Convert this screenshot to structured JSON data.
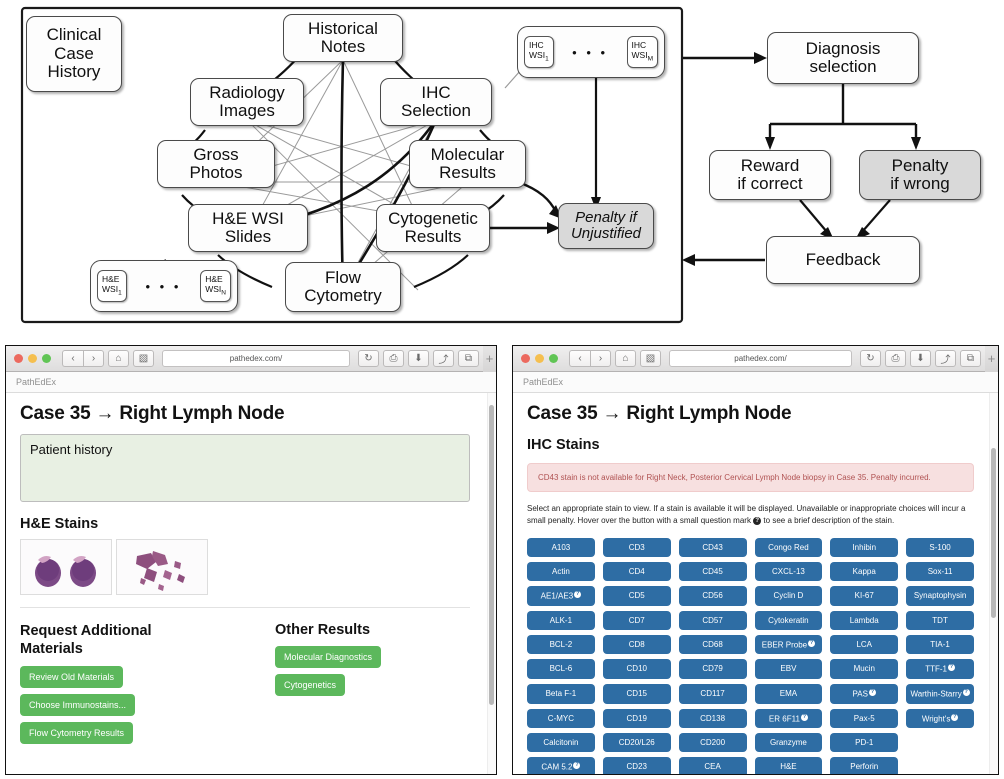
{
  "diagram": {
    "nodes": [
      {
        "id": "clinical",
        "label": "Clinical Case History"
      },
      {
        "id": "historical",
        "label": "Historical Notes"
      },
      {
        "id": "radiology",
        "label": "Radiology Images"
      },
      {
        "id": "ihc",
        "label": "IHC Selection"
      },
      {
        "id": "gross",
        "label": "Gross Photos"
      },
      {
        "id": "molecular",
        "label": "Molecular Results"
      },
      {
        "id": "hewsi",
        "label": "H&E WSI Slides"
      },
      {
        "id": "cytogenetic",
        "label": "Cytogenetic Results"
      },
      {
        "id": "flow",
        "label": "Flow Cytometry"
      },
      {
        "id": "penalty_unjust",
        "label": "Penalty if Unjustified"
      },
      {
        "id": "diagnosis",
        "label": "Diagnosis selection"
      },
      {
        "id": "reward",
        "label": "Reward if correct"
      },
      {
        "id": "penalty_wrong",
        "label": "Penalty if wrong"
      },
      {
        "id": "feedback",
        "label": "Feedback"
      }
    ],
    "clinical_line1": "Clinical",
    "clinical_line2": "Case",
    "clinical_line3": "History",
    "historical_l1": "Historical",
    "historical_l2": "Notes",
    "radiology_l1": "Radiology",
    "radiology_l2": "Images",
    "ihc_l1": "IHC",
    "ihc_l2": "Selection",
    "gross_l1": "Gross",
    "gross_l2": "Photos",
    "molecular_l1": "Molecular",
    "molecular_l2": "Results",
    "hewsi_l1": "H&E WSI",
    "hewsi_l2": "Slides",
    "cyto_l1": "Cytogenetic",
    "cyto_l2": "Results",
    "flow_l1": "Flow",
    "flow_l2": "Cytometry",
    "penalty_unjust_l1": "Penalty if",
    "penalty_unjust_l2": "Unjustified",
    "diagnosis_l1": "Diagnosis",
    "diagnosis_l2": "selection",
    "reward_l1": "Reward",
    "reward_l2": "if correct",
    "penwrong_l1": "Penalty",
    "penwrong_l2": "if wrong",
    "feedback_label": "Feedback",
    "hewsi_group": {
      "first_l1": "H&E",
      "first_l2": "WSI",
      "first_sub": "1",
      "last_l1": "H&E",
      "last_l2": "WSI",
      "last_sub": "N",
      "dots": "• • •"
    },
    "ihcwsi_group": {
      "first_l1": "IHC",
      "first_l2": "WSI",
      "first_sub": "1",
      "last_l1": "IHC",
      "last_l2": "WSI",
      "last_sub": "M",
      "dots": "• • •"
    }
  },
  "browser_left": {
    "url": "pathedex.com/",
    "bookmark": "PathEdEx",
    "title": "Case 35 → Right Lymph Node",
    "history_placeholder": "Patient history",
    "he_stains_heading": "H&E Stains",
    "request_heading_l1": "Request Additional",
    "request_heading_l2": "Materials",
    "other_heading": "Other Results",
    "request_buttons": [
      "Review Old Materials",
      "Choose Immunostains...",
      "Flow Cytometry Results"
    ],
    "other_buttons": [
      "Molecular Diagnostics",
      "Cytogenetics"
    ]
  },
  "browser_right": {
    "url": "pathedex.com/",
    "bookmark": "PathEdEx",
    "title": "Case 35 → Right Lymph Node",
    "ihc_heading": "IHC Stains",
    "alert": "CD43 stain is not available for Right Neck, Posterior Cervical Lymph Node biopsy in Case 35. Penalty incurred.",
    "instructions_a": "Select an appropriate stain to view. If a stain is available it will be displayed. Unavailable or inappropriate choices will incur a small penalty. Hover over the button with a small question mark",
    "instructions_b": "to see a brief description of the stain.",
    "stains": [
      [
        "A103",
        "CD3",
        "CD43",
        "Congo Red",
        "Inhibin",
        "S-100"
      ],
      [
        "Actin",
        "CD4",
        "CD45",
        "CXCL-13",
        "Kappa",
        "Sox-11"
      ],
      [
        "AE1/AE3*",
        "CD5",
        "CD56",
        "Cyclin D",
        "KI-67",
        "Synaptophysin"
      ],
      [
        "ALK-1",
        "CD7",
        "CD57",
        "Cytokeratin",
        "Lambda",
        "TDT"
      ],
      [
        "BCL-2",
        "CD8",
        "CD68",
        "EBER Probe*",
        "LCA",
        "TIA-1"
      ],
      [
        "BCL-6",
        "CD10",
        "CD79",
        "EBV",
        "Mucin",
        "TTF-1*"
      ],
      [
        "Beta F-1",
        "CD15",
        "CD117",
        "EMA",
        "PAS*",
        "Warthin-Starry*"
      ],
      [
        "C-MYC",
        "CD19",
        "CD138",
        "ER 6F11*",
        "Pax-5",
        "Wright's*"
      ],
      [
        "Calcitonin",
        "CD20/L26",
        "CD200",
        "Granzyme",
        "PD-1",
        ""
      ],
      [
        "CAM 5.2*",
        "CD23",
        "CEA",
        "H&E",
        "Perforin",
        ""
      ]
    ]
  },
  "colors": {
    "green_button": "#5cb85c",
    "blue_button": "#2e6da4",
    "alert_bg": "#f7e0e0",
    "alert_text": "#b05252",
    "history_bg": "#e8f0e3",
    "node_gray": "#d9d9d9"
  },
  "icons": {
    "back": "‹",
    "forward": "›",
    "home": "⌂",
    "sidebar": "▧",
    "reload": "↻",
    "print": "⎙",
    "download": "⬇",
    "share": "⤴",
    "tabs": "⧉",
    "plus": "+"
  }
}
